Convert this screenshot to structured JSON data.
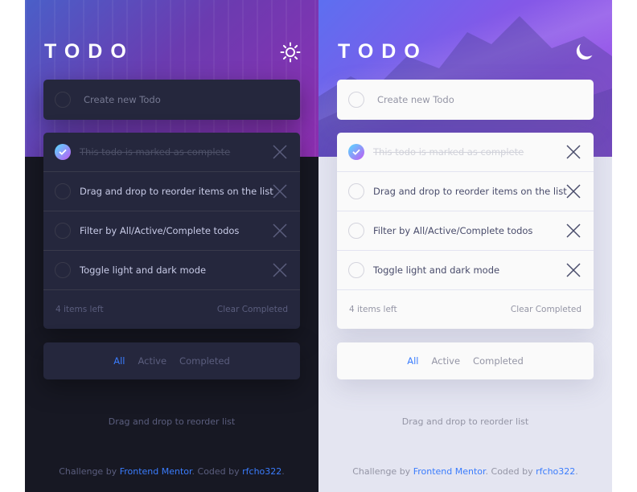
{
  "app": {
    "brand": "TODO"
  },
  "create": {
    "placeholder": "Create new Todo"
  },
  "todos": [
    {
      "text": "This todo is marked as complete",
      "completed": true
    },
    {
      "text": "Drag and drop to reorder items on the list",
      "completed": false
    },
    {
      "text": "Filter by All/Active/Complete todos",
      "completed": false
    },
    {
      "text": "Toggle light and dark mode",
      "completed": false
    }
  ],
  "footer": {
    "items_left": "4 items left",
    "clear": "Clear Completed"
  },
  "filters": {
    "all": "All",
    "active": "Active",
    "completed": "Completed",
    "selected": "All"
  },
  "hint": "Drag and drop to reorder list",
  "attribution": {
    "prefix": "Challenge by",
    "frontend_mentor": "Frontend Mentor",
    "middle": ". Coded by",
    "author": "rfcho322",
    "suffix": "."
  },
  "themes": {
    "dark": {
      "toggle_icon": "sun-icon",
      "background": "#171823",
      "card": "#25273d"
    },
    "light": {
      "toggle_icon": "moon-icon",
      "background": "#e4e5f1",
      "card": "#fafafa"
    }
  },
  "colors": {
    "accent": "#3a7cfd",
    "check_gradient_start": "#55ddff",
    "check_gradient_end": "#c058f3"
  }
}
